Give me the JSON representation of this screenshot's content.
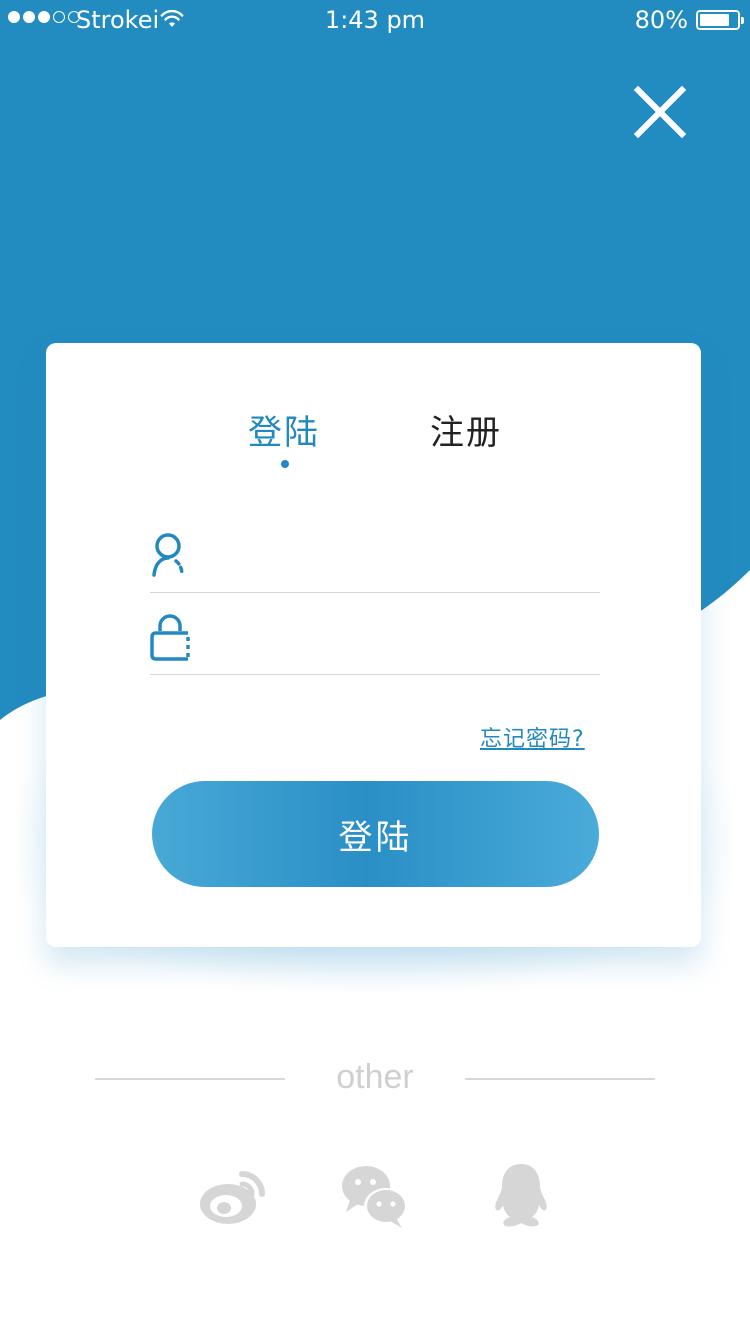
{
  "status_bar": {
    "carrier": "Strokei",
    "time": "1:43 pm",
    "battery": "80%",
    "battery_level": 0.8,
    "signal_filled": 3,
    "signal_total": 5
  },
  "tabs": [
    {
      "label": "登陆",
      "active": true
    },
    {
      "label": "注册",
      "active": false
    }
  ],
  "fields": {
    "username": {
      "placeholder": "",
      "value": "",
      "icon": "user-icon"
    },
    "password": {
      "placeholder": "",
      "value": "",
      "icon": "lock-icon"
    }
  },
  "forgot_password": "忘记密码?",
  "login_button": "登陆",
  "other": {
    "label": "other",
    "providers": [
      {
        "name": "weibo",
        "icon": "weibo-icon"
      },
      {
        "name": "wechat",
        "icon": "wechat-icon"
      },
      {
        "name": "qq",
        "icon": "qq-icon"
      }
    ]
  },
  "colors": {
    "accent": "#2288c0",
    "background_blue": "#228bbf",
    "muted": "#d6d6d6"
  }
}
